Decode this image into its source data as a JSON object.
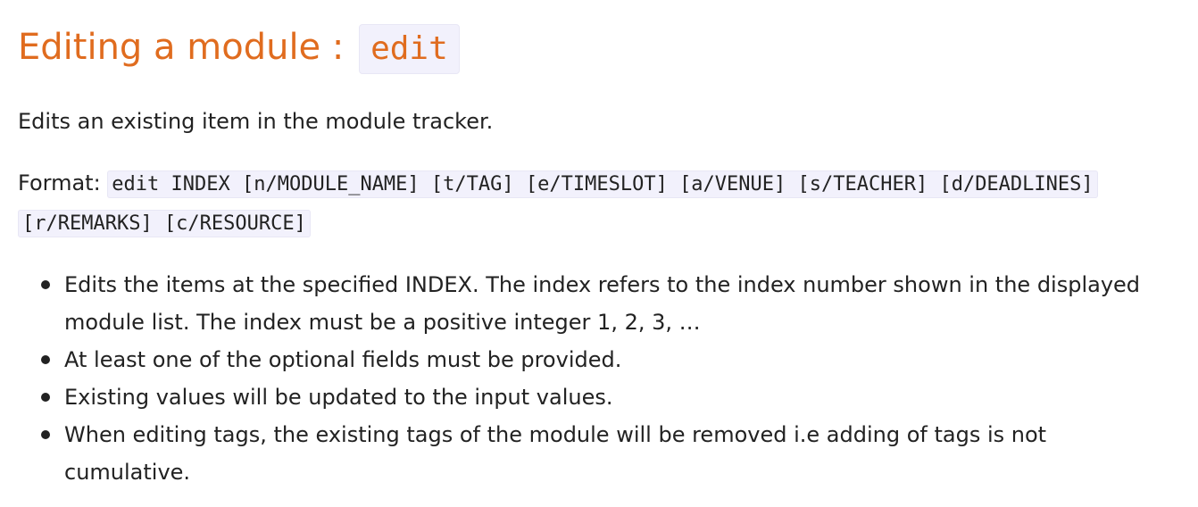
{
  "section": {
    "title": "Editing a module : ",
    "command": "edit"
  },
  "description": "Edits an existing item in the module tracker.",
  "format": {
    "label": "Format: ",
    "code": "edit INDEX [n/MODULE_NAME] [t/TAG] [e/TIMESLOT] [a/VENUE] [s/TEACHER] [d/DEADLINES] [r/REMARKS] [c/RESOURCE]"
  },
  "notes": [
    "Edits the items at the specified INDEX. The index refers to the index number shown in the displayed module list. The index must be a positive integer 1, 2, 3, …",
    "At least one of the optional fields must be provided.",
    "Existing values will be updated to the input values.",
    "When editing tags, the existing tags of the module will be removed i.e adding of tags is not cumulative."
  ],
  "colors": {
    "heading": "#e06c1f",
    "code_background": "#f2f1fc",
    "text": "#222222"
  }
}
